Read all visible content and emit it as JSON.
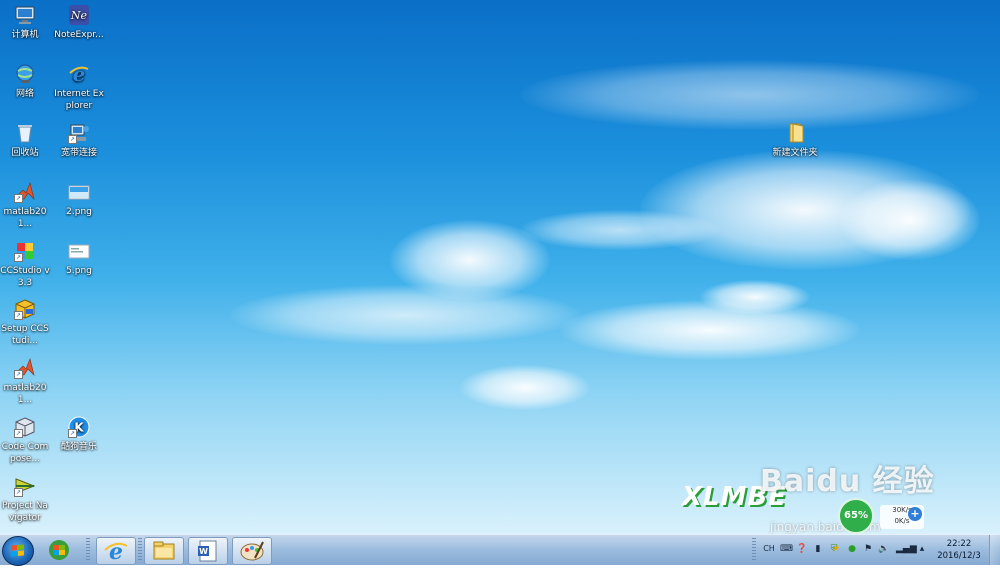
{
  "desktop": {
    "icons_left_col": [
      {
        "label": "计算机",
        "icon": "computer-icon"
      },
      {
        "label": "网络",
        "icon": "network-icon"
      },
      {
        "label": "回收站",
        "icon": "recycle-bin-icon"
      },
      {
        "label": "matlab201...",
        "icon": "matlab-icon"
      },
      {
        "label": "CCStudio v3.3",
        "icon": "ccstudio-icon"
      },
      {
        "label": "Setup CCStudi...",
        "icon": "setup-ccstudio-icon"
      },
      {
        "label": "matlab201...",
        "icon": "matlab-icon"
      },
      {
        "label": "Code Compose...",
        "icon": "code-composer-icon"
      },
      {
        "label": "Project Navigator",
        "icon": "project-navigator-icon"
      }
    ],
    "icons_second_col": [
      {
        "label": "NoteExpr...",
        "icon": "noteexpress-icon"
      },
      {
        "label": "Internet Explorer",
        "icon": "internet-explorer-icon"
      },
      {
        "label": "宽带连接",
        "icon": "broadband-connection-icon"
      },
      {
        "label": "2.png",
        "icon": "png-file-icon"
      },
      {
        "label": "5.png",
        "icon": "png-file-icon"
      },
      {
        "label": "酷狗音乐",
        "icon": "kugou-music-icon"
      }
    ],
    "folder": {
      "label": "新建文件夹",
      "icon": "folder-icon"
    },
    "wallpaper_brand": "XLMBE",
    "watermark": {
      "main": "Baidu 经验",
      "sub": "jingyan.baidu.com"
    },
    "speed_widget": {
      "percent": "65%",
      "rate_top": "30K/s",
      "rate_bottom": "0K/s"
    }
  },
  "taskbar": {
    "pinned": [
      {
        "icon": "windows-media-center-icon"
      },
      {
        "icon": "internet-explorer-icon"
      },
      {
        "icon": "windows-explorer-icon"
      },
      {
        "icon": "word-document-icon"
      },
      {
        "icon": "paint-icon"
      }
    ],
    "tray": {
      "language": "CH",
      "clock_time": "22:22",
      "clock_date": "2016/12/3"
    }
  }
}
